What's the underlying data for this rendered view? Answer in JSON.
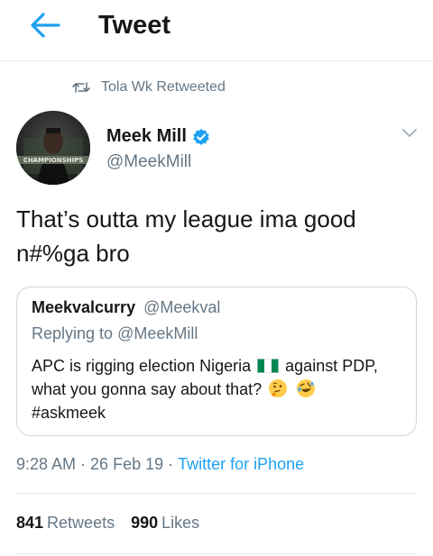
{
  "header": {
    "title": "Tweet",
    "back_icon": "arrow-left-icon",
    "accent": "#1da1f2"
  },
  "retweet_context": {
    "icon": "retweet-icon",
    "text": "Tola Wk Retweeted"
  },
  "tweet": {
    "author_name": "Meek Mill",
    "verified": true,
    "author_handle": "@MeekMill",
    "text": "That’s outta my league ima good n#%ga bro",
    "avatar_text": "CHAMPIONSHIPS",
    "timestamp": "9:28 AM",
    "date": "26 Feb 19",
    "separator": "·",
    "source": "Twitter for iPhone"
  },
  "quoted_tweet": {
    "author_name": "Meekvalcurry",
    "author_handle": "@Meekval",
    "replying_prefix": "Replying to",
    "replying_to": "@MeekMill",
    "text_part1": "APC is rigging election Nigeria",
    "text_part2": "against PDP, what you gonna say about that?",
    "hashtag": "#askmeek",
    "flag": "nigeria-flag",
    "emojis": [
      "thinking-face",
      "rolling-on-floor-laughing"
    ]
  },
  "stats": {
    "retweets_count": "841",
    "retweets_label": "Retweets",
    "likes_count": "990",
    "likes_label": "Likes"
  }
}
